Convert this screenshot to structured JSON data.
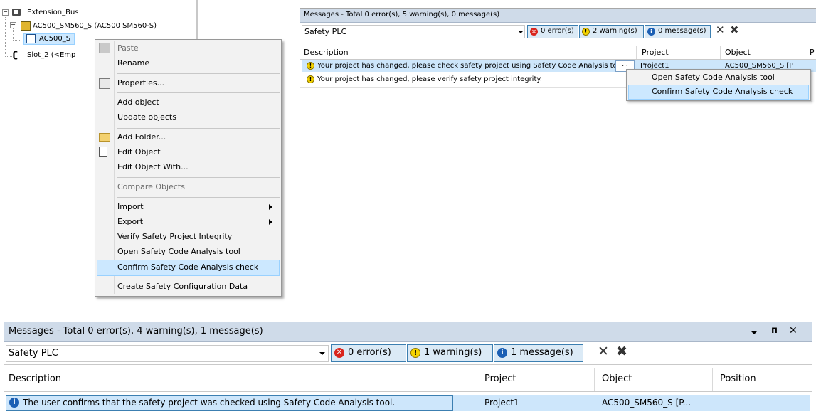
{
  "tree": {
    "bus": "Extension_Bus",
    "device": "AC500_SM560_S (AC500 SM560-S)",
    "child": "AC500_S",
    "slot": "Slot_2 (<Emp"
  },
  "context_menu": {
    "items": [
      {
        "label": "Paste",
        "disabled": true
      },
      {
        "label": "Rename"
      },
      {
        "label": "Properties..."
      },
      {
        "label": "Add object"
      },
      {
        "label": "Update objects"
      },
      {
        "label": "Add Folder..."
      },
      {
        "label": "Edit Object"
      },
      {
        "label": "Edit Object With..."
      },
      {
        "label": "Compare Objects",
        "disabled": true
      },
      {
        "label": "Import"
      },
      {
        "label": "Export"
      },
      {
        "label": "Verify Safety Project Integrity"
      },
      {
        "label": "Open Safety Code Analysis tool"
      },
      {
        "label": "Confirm Safety Code Analysis check",
        "highlighted": true
      },
      {
        "label": "Create Safety Configuration Data"
      }
    ]
  },
  "top_messages": {
    "title": "Messages - Total 0 error(s), 5 warning(s), 0 message(s)",
    "filter": "Safety PLC",
    "errors": "0 error(s)",
    "warnings": "2 warning(s)",
    "messages": "0 message(s)",
    "columns": [
      "Description",
      "Project",
      "Object",
      "P"
    ],
    "rows": [
      {
        "description": "Your project has changed, please check safety project using Safety Code Analysis tool.",
        "button": "...",
        "project": "Project1",
        "object": "AC500_SM560_S [P"
      },
      {
        "description": "Your project has changed, please verify safety project integrity."
      }
    ],
    "dropdown": [
      "Open Safety Code Analysis tool",
      "Confirm Safety Code Analysis check"
    ]
  },
  "bottom_messages": {
    "title": "Messages - Total 0 error(s), 4 warning(s), 1 message(s)",
    "pin": "ᴨ",
    "close": "✕",
    "filter": "Safety PLC",
    "errors": "0 error(s)",
    "warnings": "1 warning(s)",
    "messages": "1 message(s)",
    "columns": [
      "Description",
      "Project",
      "Object",
      "Position"
    ],
    "row": {
      "description": "The user confirms that the safety project was checked using Safety Code Analysis tool.",
      "project": "Project1",
      "object": "AC500_SM560_S [P..."
    }
  },
  "colors": {
    "selection": "#cce8ff",
    "titlebar": "#cfdbe9"
  }
}
